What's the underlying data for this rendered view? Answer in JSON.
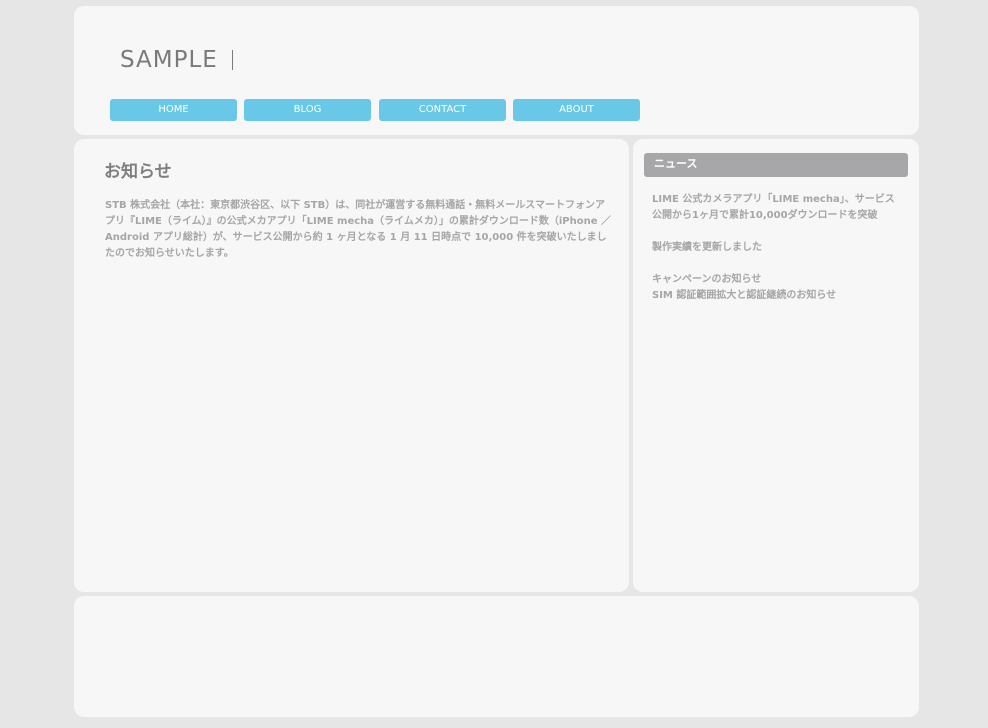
{
  "header": {
    "logo": "SAMPLE",
    "nav": [
      {
        "label": "HOME"
      },
      {
        "label": "BLOG"
      },
      {
        "label": "CONTACT"
      },
      {
        "label": "ABOUT"
      }
    ]
  },
  "main": {
    "title": "お知らせ",
    "body": "STB 株式会社（本社：東京都渋谷区、以下 STB）は、同社が運営する無料通話・無料メールスマートフォンアプリ『LIME（ライム）』の公式メカアプリ「LIME mecha（ライムメカ）」の累計ダウンロード数（iPhone ／ Android アプリ総計）が、サービス公開から約 1 ヶ月となる 1 月 11 日時点で 10,000 件を突破いたしましたのでお知らせいたします。"
  },
  "sidebar": {
    "title": "ニュース",
    "items": [
      "LIME 公式カメラアプリ「LIME mecha」、サービス公開から1ヶ月で累計10,000ダウンロードを突破",
      "製作実績を更新しました",
      "キャンペーンのお知らせ",
      "SIM 認証範囲拡大と認証継続のお知らせ"
    ]
  }
}
